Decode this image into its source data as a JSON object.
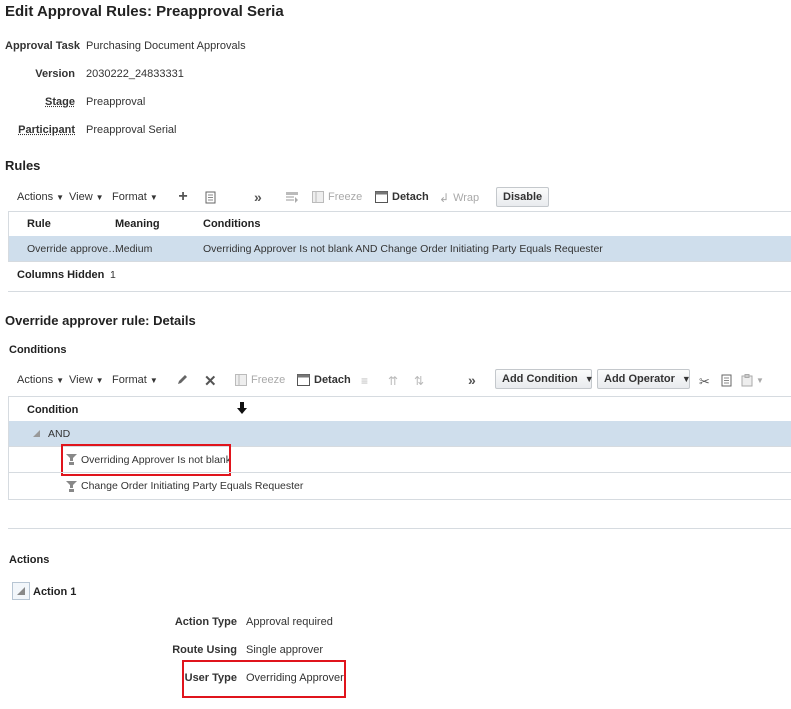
{
  "page": {
    "title": "Edit Approval Rules: Preapproval Seria"
  },
  "fields": [
    {
      "label": "Approval Task",
      "value": "Purchasing Document Approvals"
    },
    {
      "label": "Version",
      "value": "2030222_24833331"
    },
    {
      "label": "Stage",
      "value": "Preapproval"
    },
    {
      "label": "Participant",
      "value": "Preapproval Serial"
    }
  ],
  "rules": {
    "heading": "Rules",
    "toolbar": {
      "actions": "Actions",
      "view": "View",
      "format": "Format",
      "freeze": "Freeze",
      "detach": "Detach",
      "wrap": "Wrap",
      "disable": "Disable"
    },
    "columns": [
      "Rule",
      "Meaning",
      "Conditions"
    ],
    "rows": [
      {
        "rule": "Override approve…",
        "meaning": "Medium",
        "conditions": "Overriding Approver Is not blank AND Change Order Initiating Party Equals Requester"
      }
    ],
    "columns_hidden_label": "Columns Hidden",
    "columns_hidden_value": "1"
  },
  "details": {
    "heading": "Override approver rule: Details",
    "conditions_heading": "Conditions",
    "toolbar": {
      "actions": "Actions",
      "view": "View",
      "format": "Format",
      "freeze": "Freeze",
      "detach": "Detach",
      "add_condition": "Add Condition",
      "add_operator": "Add Operator"
    },
    "column": "Condition",
    "operator": "AND",
    "conditions": [
      "Overriding Approver Is not blank",
      "Change Order Initiating Party Equals Requester"
    ]
  },
  "actions": {
    "heading": "Actions",
    "action_label": "Action 1",
    "fields": [
      {
        "label": "Action Type",
        "value": "Approval required"
      },
      {
        "label": "Route Using",
        "value": "Single approver"
      },
      {
        "label": "User Type",
        "value": "Overriding Approver"
      }
    ]
  },
  "colors": {
    "selected_row": "#cfdeec",
    "highlight_box": "#e0141c",
    "border": "#d6dbe0"
  }
}
